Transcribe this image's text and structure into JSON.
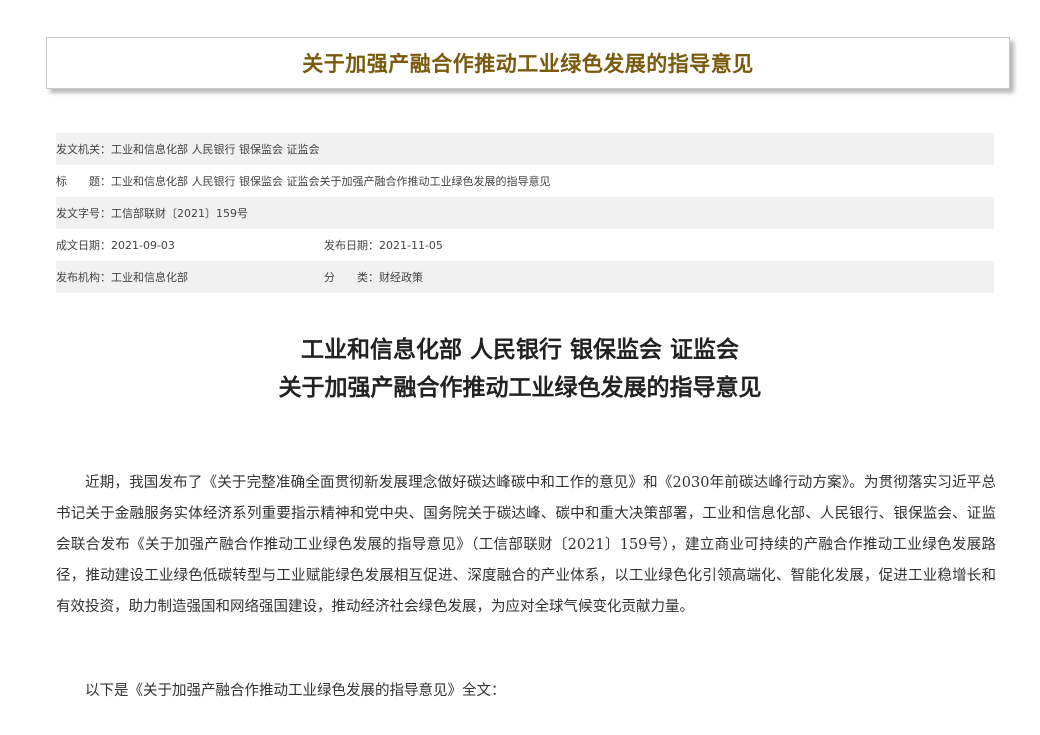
{
  "banner": {
    "title": "关于加强产融合作推动工业绿色发展的指导意见"
  },
  "meta": {
    "issuer": {
      "label": "发文机关：",
      "value": "工业和信息化部 人民银行 银保监会 证监会"
    },
    "subject": {
      "label": "标　　题：",
      "value": "工业和信息化部 人民银行 银保监会 证监会关于加强产融合作推动工业绿色发展的指导意见"
    },
    "doc_number": {
      "label": "发文字号：",
      "value": "工信部联财〔2021〕159号"
    },
    "written_date": {
      "label": "成文日期：",
      "value": "2021-09-03"
    },
    "publish_date": {
      "label": "发布日期：",
      "value": "2021-11-05"
    },
    "publisher": {
      "label": "发布机构：",
      "value": "工业和信息化部"
    },
    "category": {
      "label": "分　　类：",
      "value": "财经政策"
    }
  },
  "document": {
    "title_line1": "工业和信息化部 人民银行 银保监会 证监会",
    "title_line2": "关于加强产融合作推动工业绿色发展的指导意见",
    "paragraph1": "近期，我国发布了《关于完整准确全面贯彻新发展理念做好碳达峰碳中和工作的意见》和《2030年前碳达峰行动方案》。为贯彻落实习近平总书记关于金融服务实体经济系列重要指示精神和党中央、国务院关于碳达峰、碳中和重大决策部署，工业和信息化部、人民银行、银保监会、证监会联合发布《关于加强产融合作推动工业绿色发展的指导意见》（工信部联财〔2021〕159号），建立商业可持续的产融合作推动工业绿色发展路径，推动建设工业绿色低碳转型与工业赋能绿色发展相互促进、深度融合的产业体系，以工业绿色化引领高端化、智能化发展，促进工业稳增长和有效投资，助力制造强国和网络强国建设，推动经济社会绿色发展，为应对全球气候变化贡献力量。",
    "paragraph2": "以下是《关于加强产融合作推动工业绿色发展的指导意见》全文："
  }
}
